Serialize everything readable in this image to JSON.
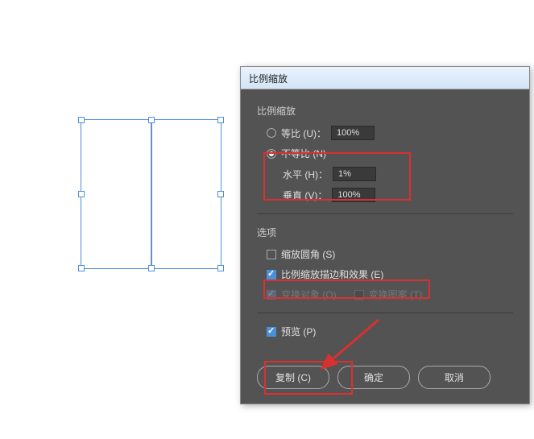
{
  "dialog": {
    "title": "比例缩放",
    "section_scale": "比例缩放",
    "uniform_label": "等比 (U)：",
    "uniform_value": "100%",
    "nonuniform_label": "不等比 (N)",
    "horizontal_label": "水平 (H)：",
    "horizontal_value": "1%",
    "vertical_label": "垂直 (V)：",
    "vertical_value": "100%",
    "section_options": "选项",
    "scale_corners_label": "缩放圆角 (S)",
    "scale_strokes_label": "比例缩放描边和效果 (E)",
    "transform_objects_label": "变换对象 (O)",
    "transform_patterns_label": "变换图案 (T)",
    "preview_label": "预览 (P)",
    "btn_copy": "复制 (C)",
    "btn_ok": "确定",
    "btn_cancel": "取消"
  }
}
